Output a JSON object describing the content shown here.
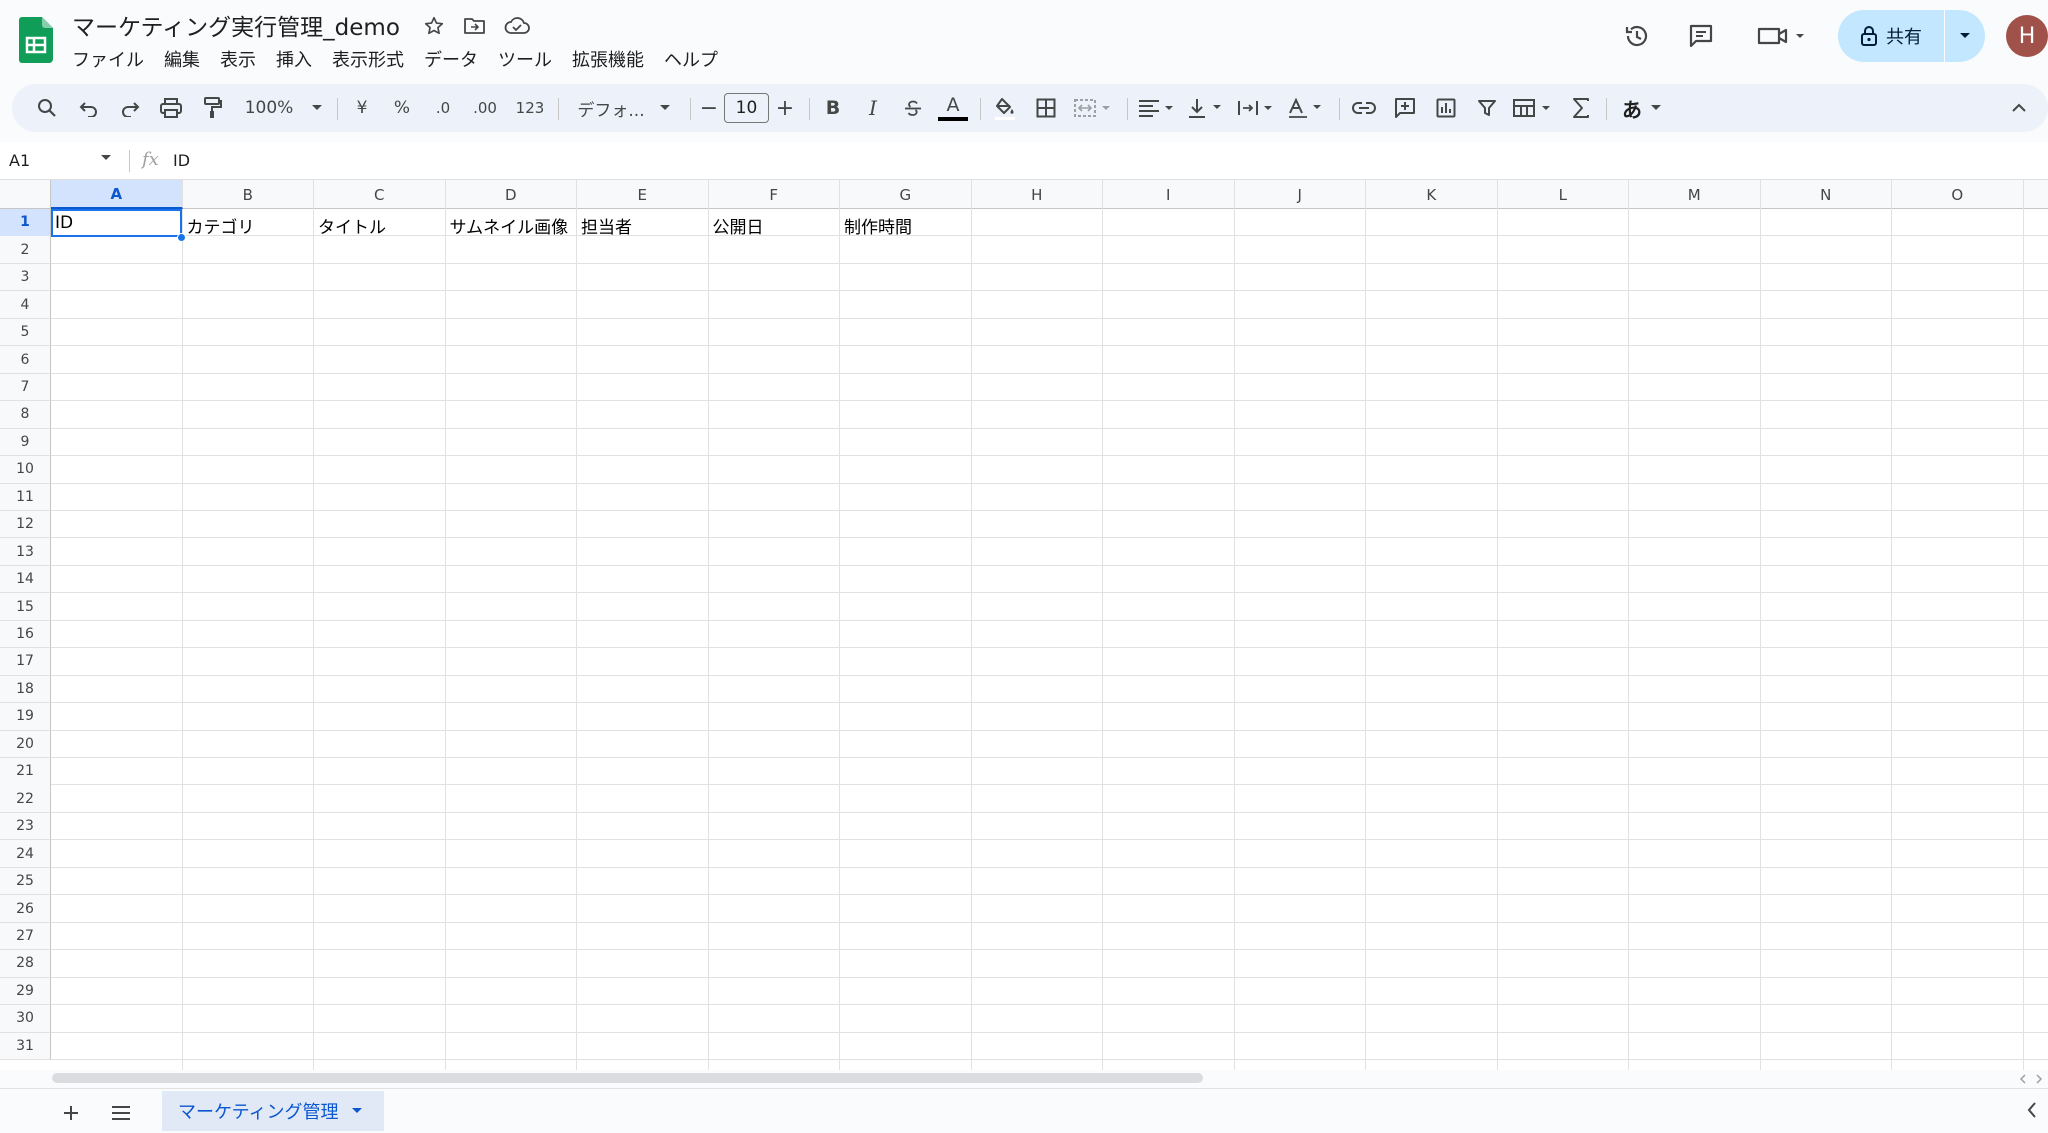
{
  "document": {
    "title": "マーケティング実行管理_demo",
    "title_icons": [
      "star-icon",
      "move-folder-icon",
      "cloud-saved-icon"
    ]
  },
  "menu": [
    "ファイル",
    "編集",
    "表示",
    "挿入",
    "表示形式",
    "データ",
    "ツール",
    "拡張機能",
    "ヘルプ"
  ],
  "header_actions": {
    "share_label": "共有",
    "avatar_initial": "H"
  },
  "toolbar": {
    "zoom": "100%",
    "currency": "¥",
    "percent": "%",
    "decrease_decimal": ".0",
    "increase_decimal": ".00",
    "number_format": "123",
    "font_family": "デフォ...",
    "font_size": "10",
    "minus": "−",
    "plus": "+",
    "bold": "B",
    "italic": "I",
    "text_color_letter": "A",
    "input_tools": "あ"
  },
  "formula_bar": {
    "name_box": "A1",
    "fx": "fx",
    "content": "ID"
  },
  "sheet": {
    "columns": [
      "A",
      "B",
      "C",
      "D",
      "E",
      "F",
      "G",
      "H",
      "I",
      "J",
      "K",
      "L",
      "M",
      "N",
      "O"
    ],
    "rows": [
      "1",
      "2",
      "3",
      "4",
      "5",
      "6",
      "7",
      "8",
      "9",
      "10",
      "11",
      "12",
      "13",
      "14",
      "15",
      "16",
      "17",
      "18",
      "19",
      "20",
      "21",
      "22",
      "23",
      "24",
      "25",
      "26",
      "27",
      "28",
      "29",
      "30",
      "31"
    ],
    "row1": [
      "ID",
      "カテゴリ",
      "タイトル",
      "サムネイル画像",
      "担当者",
      "公開日",
      "制作時間"
    ],
    "selected_cell": "A1"
  },
  "tabs": {
    "active_sheet": "マーケティング管理"
  },
  "colors": {
    "accent": "#0b57d0",
    "selection": "#1a73e8",
    "share_bg": "#c2e7ff",
    "sheets_green": "#0f9d58"
  }
}
